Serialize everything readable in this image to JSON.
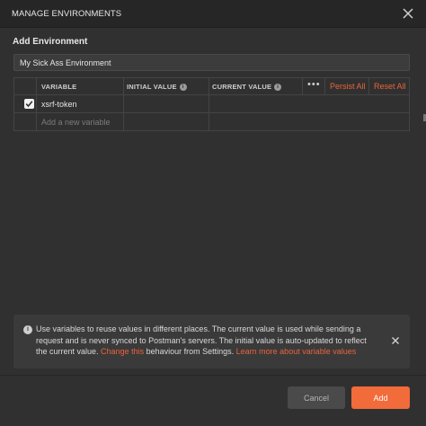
{
  "modal": {
    "title": "MANAGE ENVIRONMENTS",
    "section_label": "Add Environment",
    "env_name_value": "My Sick Ass Environment"
  },
  "table": {
    "headers": {
      "variable": "VARIABLE",
      "initial_value": "INITIAL VALUE",
      "current_value": "CURRENT VALUE"
    },
    "more_label": "•••",
    "persist_all": "Persist All",
    "reset_all": "Reset All",
    "rows": [
      {
        "checked": true,
        "variable": "xsrf-token",
        "initial_value": "",
        "current_value": ""
      }
    ],
    "new_variable_placeholder": "Add a new variable"
  },
  "banner": {
    "text_part1": "Use variables to reuse values in different places. The current value is used while sending a request and is never synced to Postman's servers. The initial value is auto-updated to reflect the current value. ",
    "change_link": "Change this",
    "text_part2": " behaviour from Settings. ",
    "learn_link": "Learn more about variable values"
  },
  "footer": {
    "cancel_label": "Cancel",
    "add_label": "Add"
  },
  "colors": {
    "accent": "#f26b3a",
    "link": "#e8643b",
    "background": "#303030"
  },
  "icons": {
    "close": "close-icon",
    "info": "info-icon",
    "checkbox": "checkbox-checked-icon"
  }
}
